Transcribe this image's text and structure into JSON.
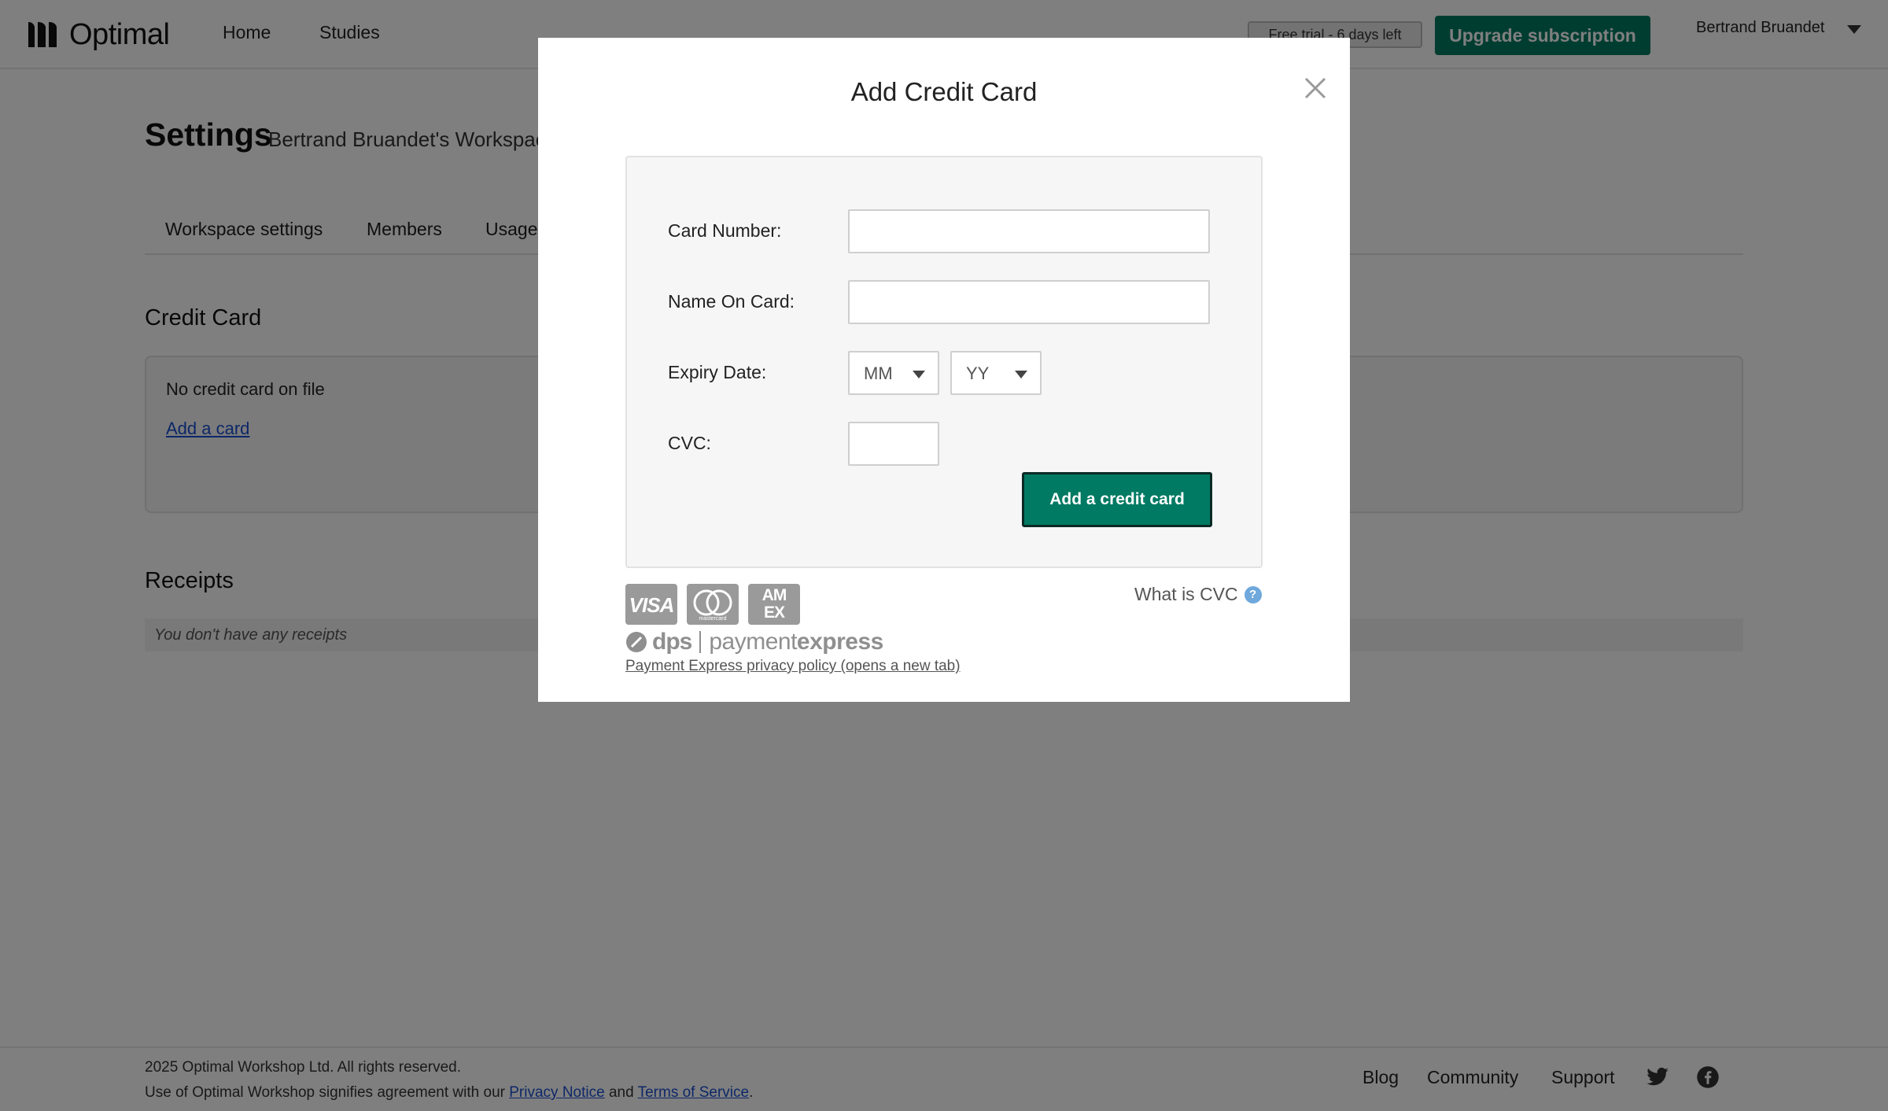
{
  "header": {
    "logo_text": "Optimal",
    "nav": [
      {
        "label": "Home"
      },
      {
        "label": "Studies"
      }
    ],
    "trial_badge": "Free trial - 6 days left",
    "upgrade_label": "Upgrade subscription",
    "user_name": "Bertrand Bruandet"
  },
  "page": {
    "title": "Settings",
    "subtitle": "Bertrand Bruandet's Workspace",
    "tabs": [
      {
        "label": "Workspace settings"
      },
      {
        "label": "Members"
      },
      {
        "label": "Usage"
      }
    ],
    "credit_card": {
      "heading": "Credit Card",
      "status": "No credit card on file",
      "add_link": "Add a card"
    },
    "receipts": {
      "heading": "Receipts",
      "empty_text": "You don't have any receipts"
    }
  },
  "footer": {
    "copyright": "2025 Optimal Workshop Ltd. All rights reserved.",
    "terms_prefix": "Use of Optimal Workshop signifies agreement with our ",
    "privacy_label": "Privacy Notice",
    "terms_and": " and ",
    "terms_label": "Terms of Service",
    "terms_suffix": ".",
    "links": [
      {
        "label": "Blog"
      },
      {
        "label": "Community"
      },
      {
        "label": "Support"
      }
    ]
  },
  "modal": {
    "title": "Add Credit Card",
    "form": {
      "card_number_label": "Card Number:",
      "card_number_value": "",
      "name_label": "Name On Card:",
      "name_value": "",
      "expiry_label": "Expiry Date:",
      "month_selected": "MM",
      "year_selected": "YY",
      "cvc_label": "CVC:",
      "cvc_value": "",
      "submit_label": "Add a credit card"
    },
    "card_brands": {
      "visa": "VISA",
      "mastercard": "mastercard",
      "amex_line1": "AM",
      "amex_line2": "EX"
    },
    "processor": {
      "dps": "dps",
      "payment": "payment",
      "express": "express"
    },
    "privacy_link": "Payment Express privacy policy (opens a new tab)",
    "cvc_help": "What is CVC",
    "help_glyph": "?"
  },
  "colors": {
    "brand_green": "#017a63",
    "link_blue": "#1a4fd0",
    "overlay": "rgba(0,0,0,0.5)"
  }
}
